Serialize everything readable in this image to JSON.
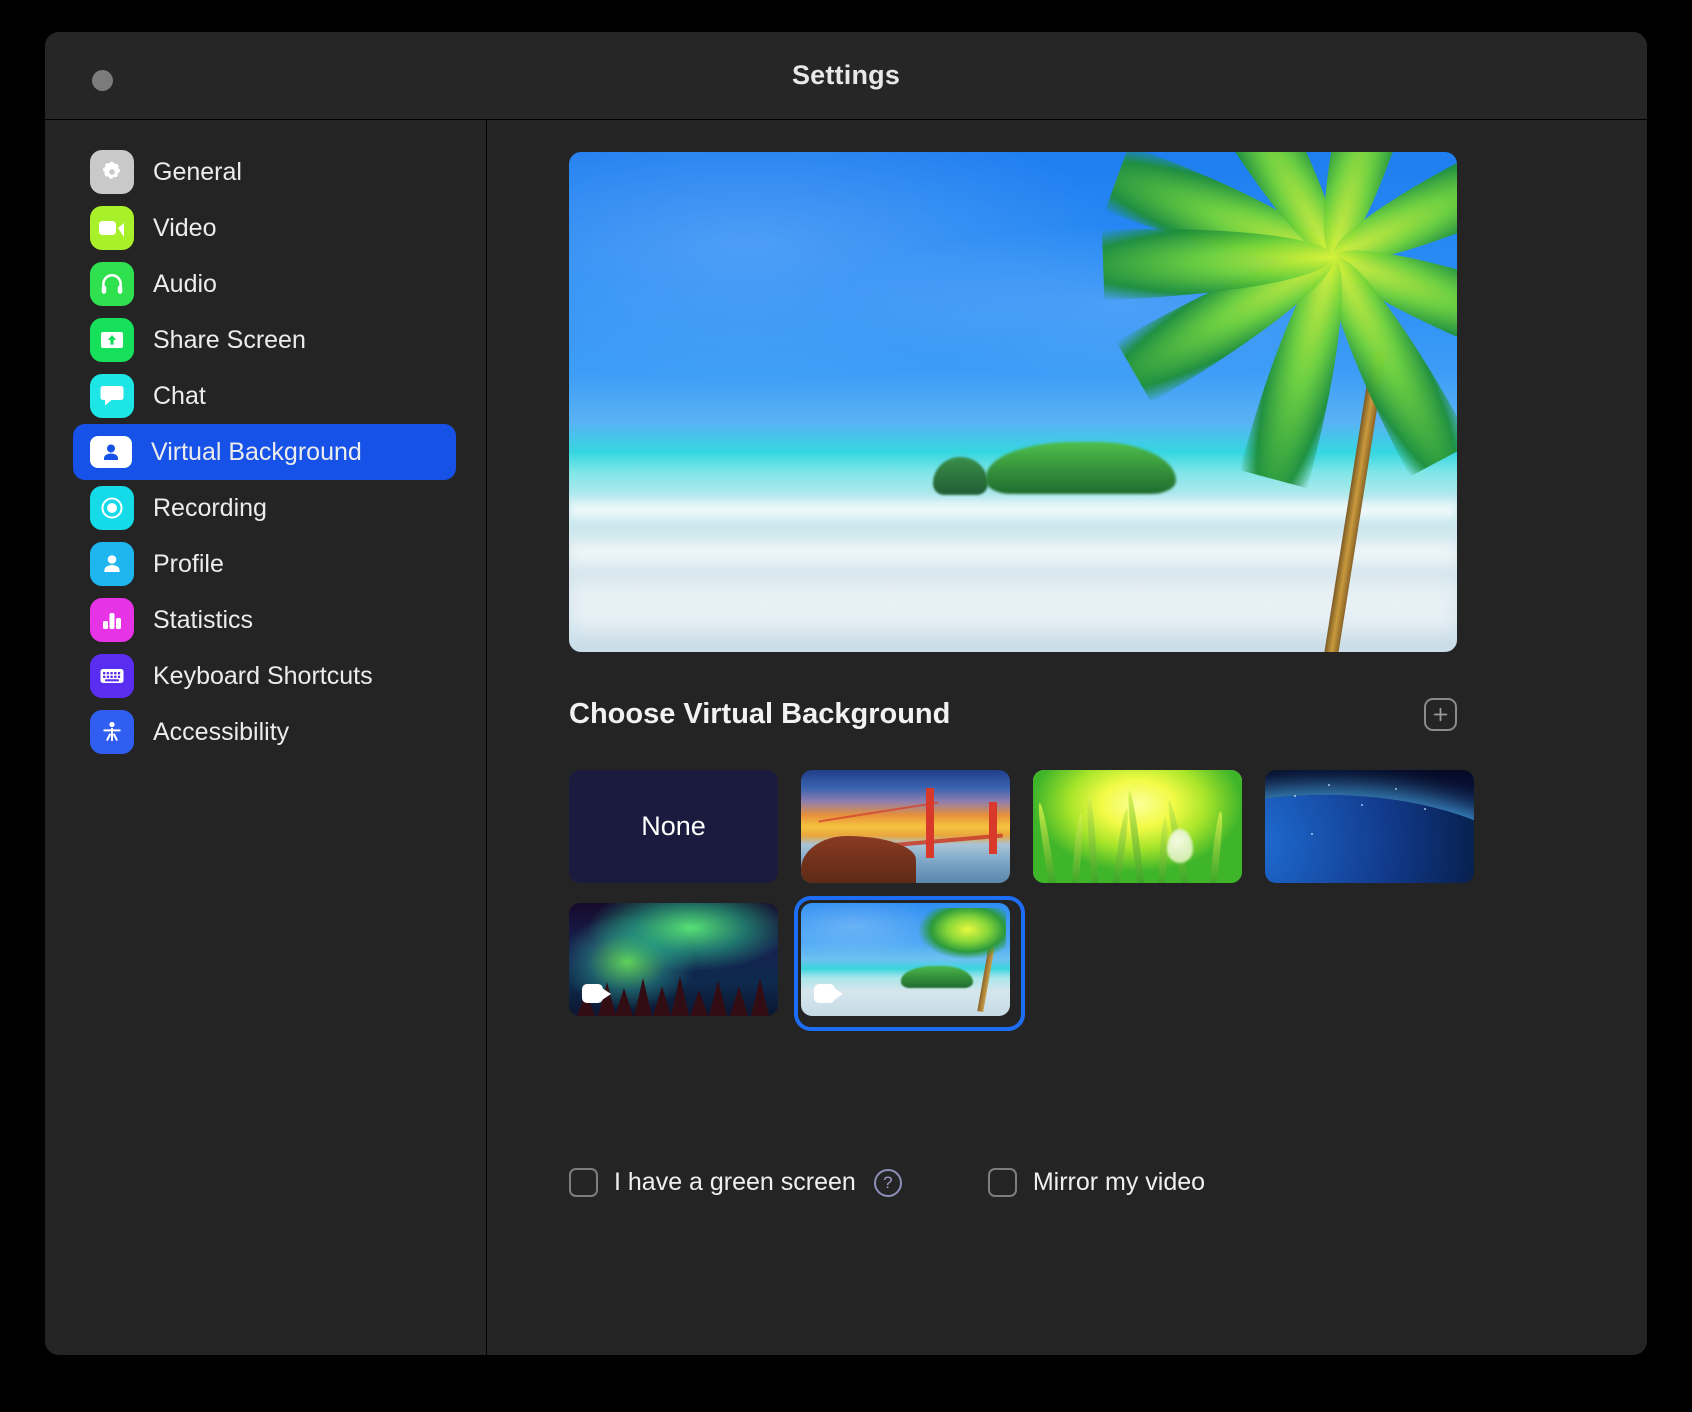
{
  "window": {
    "title": "Settings",
    "close_button": "close"
  },
  "sidebar": {
    "items": [
      {
        "label": "General",
        "icon": "gear-icon",
        "color": "#c9c9c9",
        "active": false
      },
      {
        "label": "Video",
        "icon": "video-icon",
        "color": "#a8f02a",
        "active": false
      },
      {
        "label": "Audio",
        "icon": "headphones-icon",
        "color": "#2fe04f",
        "active": false
      },
      {
        "label": "Share Screen",
        "icon": "share-screen-icon",
        "color": "#17e05a",
        "active": false
      },
      {
        "label": "Chat",
        "icon": "chat-icon",
        "color": "#1fe6e6",
        "active": false
      },
      {
        "label": "Virtual Background",
        "icon": "person-card-icon",
        "color": "#1652e8",
        "active": true
      },
      {
        "label": "Recording",
        "icon": "record-icon",
        "color": "#15dbe8",
        "active": false
      },
      {
        "label": "Profile",
        "icon": "person-icon",
        "color": "#1fb6f0",
        "active": false
      },
      {
        "label": "Statistics",
        "icon": "bar-chart-icon",
        "color": "#e633e6",
        "active": false
      },
      {
        "label": "Keyboard Shortcuts",
        "icon": "keyboard-icon",
        "color": "#5a2ef0",
        "active": false
      },
      {
        "label": "Accessibility",
        "icon": "accessibility-icon",
        "color": "#2f5ef0",
        "active": false
      }
    ]
  },
  "main": {
    "preview_alt": "tropical-beach-preview",
    "section_title": "Choose Virtual Background",
    "add_button_label": "+",
    "thumbnails": [
      {
        "name": "None",
        "art": "none",
        "selected": false,
        "video": false
      },
      {
        "name": "Golden Gate Bridge",
        "art": "bridge",
        "selected": false,
        "video": false
      },
      {
        "name": "Grass Field",
        "art": "grass",
        "selected": false,
        "video": false
      },
      {
        "name": "Earth From Space",
        "art": "earth",
        "selected": false,
        "video": false
      },
      {
        "name": "Aurora Borealis",
        "art": "aurora",
        "selected": false,
        "video": true
      },
      {
        "name": "Tropical Beach",
        "art": "beach",
        "selected": true,
        "video": true
      }
    ],
    "options": {
      "green_screen_label": "I have a green screen",
      "green_screen_checked": false,
      "help_glyph": "?",
      "mirror_label": "Mirror my video",
      "mirror_checked": false
    }
  }
}
